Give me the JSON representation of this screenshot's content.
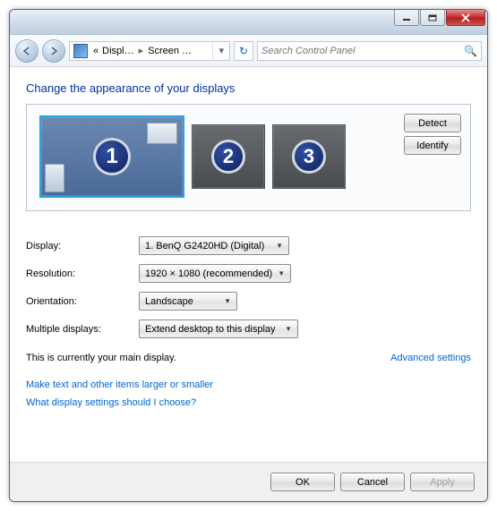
{
  "titlebar": {
    "minimize": "minimize",
    "maximize": "maximize",
    "close": "close"
  },
  "nav": {
    "breadcrumb": {
      "prefix": "«",
      "seg1": "Displ…",
      "seg2": "Screen …"
    },
    "search_placeholder": "Search Control Panel"
  },
  "heading": "Change the appearance of your displays",
  "monitors": {
    "m1": "1",
    "m2": "2",
    "m3": "3"
  },
  "sidebuttons": {
    "detect": "Detect",
    "identify": "Identify"
  },
  "form": {
    "display_label": "Display:",
    "display_value": "1. BenQ G2420HD (Digital)",
    "resolution_label": "Resolution:",
    "resolution_value": "1920 × 1080 (recommended)",
    "orientation_label": "Orientation:",
    "orientation_value": "Landscape",
    "multiple_label": "Multiple displays:",
    "multiple_value": "Extend desktop to this display"
  },
  "status": "This is currently your main display.",
  "advanced": "Advanced settings",
  "links": {
    "l1": "Make text and other items larger or smaller",
    "l2": "What display settings should I choose?"
  },
  "footer": {
    "ok": "OK",
    "cancel": "Cancel",
    "apply": "Apply"
  }
}
